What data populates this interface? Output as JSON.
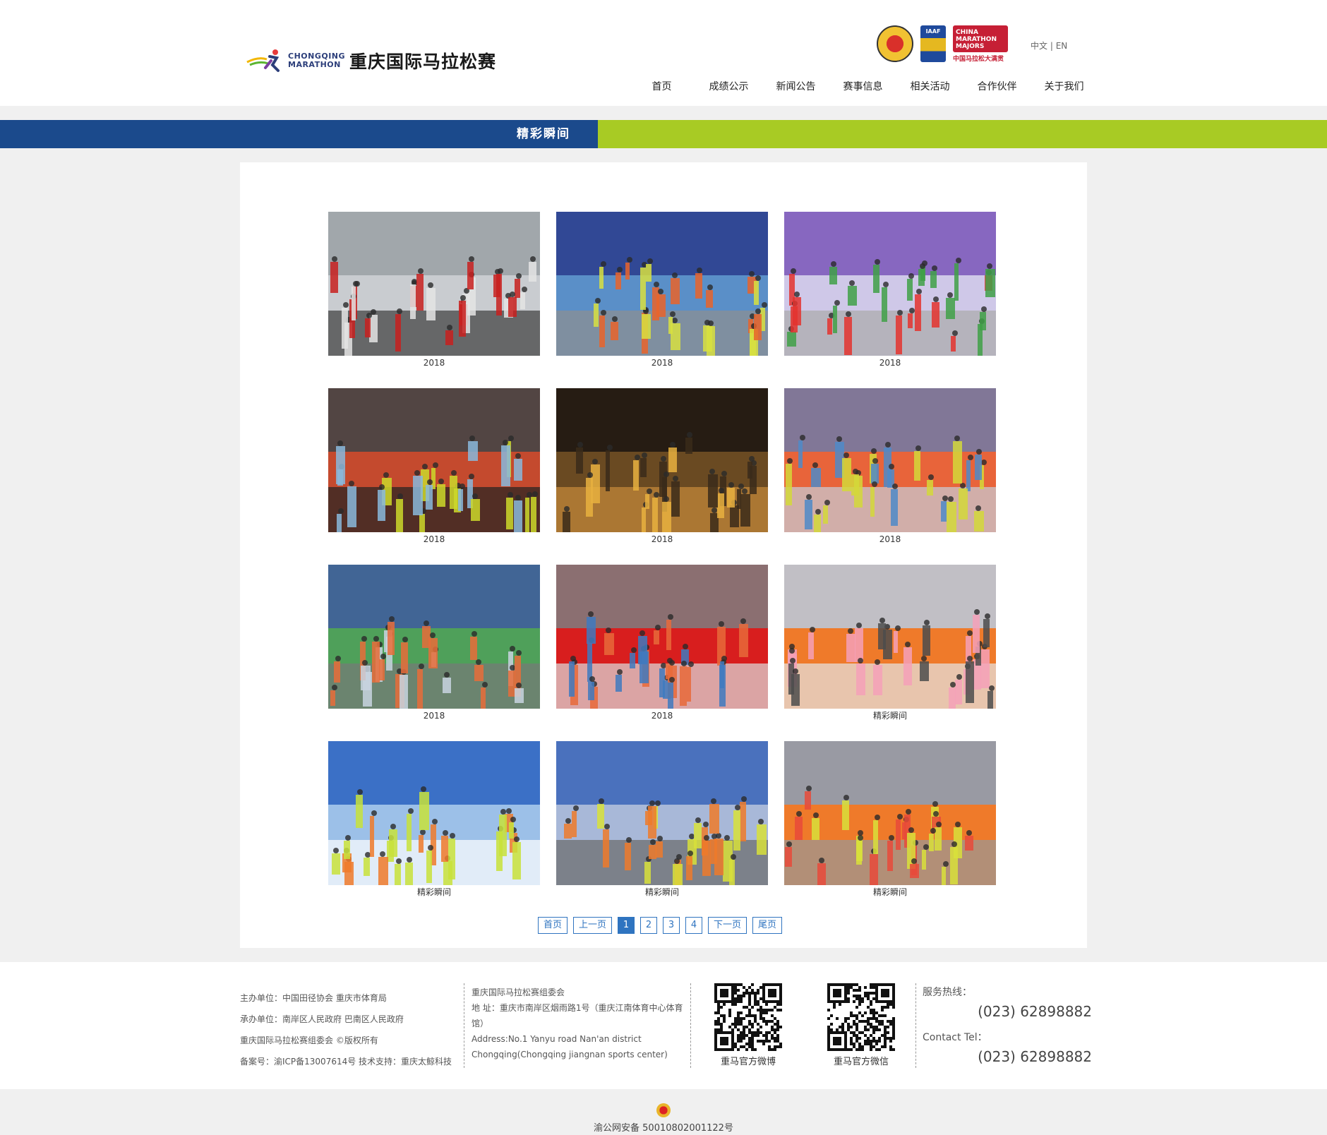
{
  "header": {
    "logo_en_line1": "CHONGQING",
    "logo_en_line2": "MARATHON",
    "logo_cn": "重庆国际马拉松赛",
    "badge_iaaf": "IAAF",
    "badge_china_line1": "CHINA",
    "badge_china_line2": "MARATHON",
    "badge_china_line3": "MAJORS",
    "badge_china_caption": "中国马拉松大满贯",
    "lang_cn": "中文",
    "lang_sep": "|",
    "lang_en": "EN",
    "nav": [
      "首页",
      "成绩公示",
      "新闻公告",
      "赛事信息",
      "相关活动",
      "合作伙伴",
      "关于我们"
    ]
  },
  "band": {
    "title": "精彩瞬间"
  },
  "gallery": {
    "items": [
      {
        "caption": "2018",
        "scene": "volunteers"
      },
      {
        "caption": "2018",
        "scene": "elite-runners"
      },
      {
        "caption": "2018",
        "scene": "start-arch"
      },
      {
        "caption": "2018",
        "scene": "resting-volunteer"
      },
      {
        "caption": "2018",
        "scene": "night-street"
      },
      {
        "caption": "2018",
        "scene": "crowd"
      },
      {
        "caption": "2018",
        "scene": "banner-crowd"
      },
      {
        "caption": "2018",
        "scene": "mascot"
      },
      {
        "caption": "精彩瞬间",
        "scene": "runners-orange"
      },
      {
        "caption": "精彩瞬间",
        "scene": "arch-2017"
      },
      {
        "caption": "精彩瞬间",
        "scene": "arch-2017b"
      },
      {
        "caption": "精彩瞬间",
        "scene": "crowd-city"
      }
    ]
  },
  "pager": {
    "first": "首页",
    "prev": "上一页",
    "pages": [
      "1",
      "2",
      "3",
      "4"
    ],
    "current": "1",
    "next": "下一页",
    "last": "尾页"
  },
  "footer": {
    "organizer": "主办单位：中国田径协会 重庆市体育局",
    "undertaker": "承办单位：南岸区人民政府 巴南区人民政府",
    "copyright": "重庆国际马拉松赛组委会 ©版权所有",
    "icp": "备案号：渝ICP备13007614号  技术支持：重庆太鲸科技",
    "committee": "重庆国际马拉松赛组委会",
    "address_cn": "地 址：重庆市南岸区烟雨路1号（重庆江南体育中心体育馆）",
    "address_en1": "Address:No.1 Yanyu road Nan'an district",
    "address_en2": "Chongqing(Chongqing jiangnan sports center)",
    "qr_weibo_label": "重马官方微博",
    "qr_wechat_label": "重马官方微信",
    "hotline_label": "服务热线：",
    "hotline": "(023) 62898882",
    "contact_label": "Contact Tel：",
    "contact": "(023) 62898882"
  },
  "bottom": {
    "beian": "渝公网安备 50010802001122号"
  },
  "colors": {
    "blue": "#1b4a8c",
    "green": "#a8cb24",
    "pager": "#2f74c0"
  }
}
